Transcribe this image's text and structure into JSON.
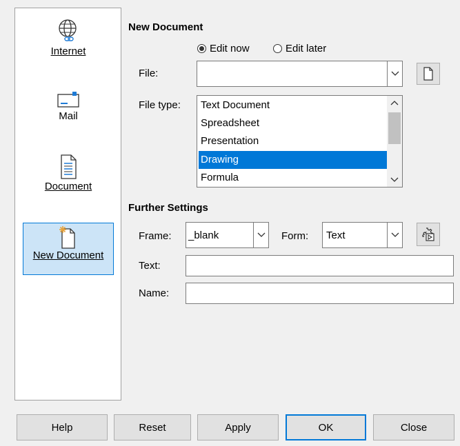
{
  "sidebar": {
    "items": [
      {
        "label": "Internet",
        "icon": "globe-link-icon"
      },
      {
        "label": "Mail",
        "icon": "mail-icon"
      },
      {
        "label": "Document",
        "icon": "document-icon"
      },
      {
        "label": "New Document",
        "icon": "new-document-icon"
      }
    ],
    "selected_index": 3
  },
  "new_document": {
    "heading": "New Document",
    "edit_now_label": "Edit now",
    "edit_later_label": "Edit later",
    "edit_mode": "Edit now",
    "file_label": "File:",
    "file_value": "",
    "file_type_label": "File type:",
    "file_types": [
      "Text Document",
      "Spreadsheet",
      "Presentation",
      "Drawing",
      "Formula"
    ],
    "selected_file_type": "Drawing"
  },
  "further_settings": {
    "heading": "Further Settings",
    "frame_label": "Frame:",
    "frame_value": "_blank",
    "form_label": "Form:",
    "form_value": "Text",
    "text_label": "Text:",
    "text_value": "",
    "name_label": "Name:",
    "name_value": ""
  },
  "buttons": {
    "help": "Help",
    "reset": "Reset",
    "apply": "Apply",
    "ok": "OK",
    "close": "Close"
  },
  "colors": {
    "selection": "#0078d7",
    "sidebar_selection": "#cce4f7",
    "dialog_bg": "#f0f0f0"
  }
}
